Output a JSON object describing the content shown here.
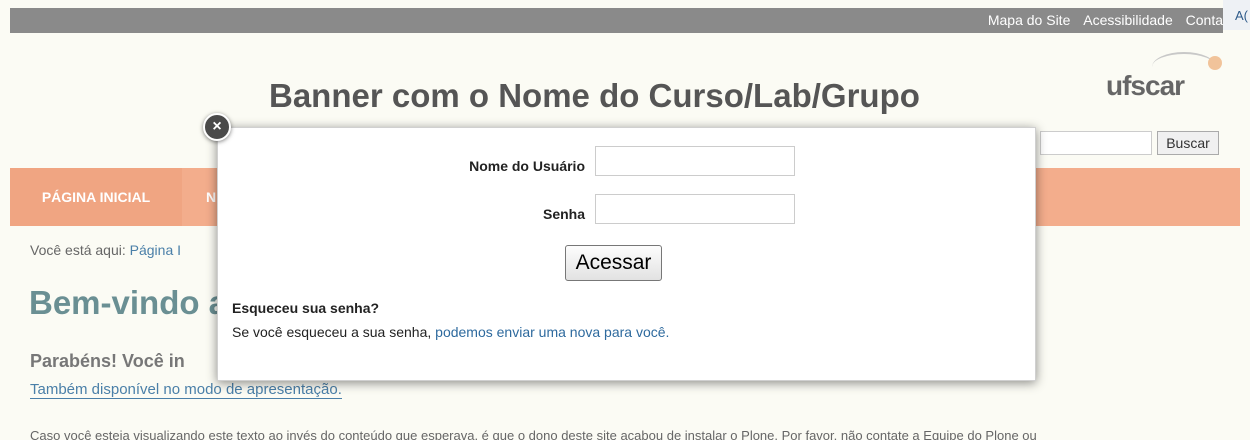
{
  "topbar": {
    "links": [
      "Mapa do Site",
      "Acessibilidade",
      "Conta"
    ],
    "right_tab_label": "A("
  },
  "banner": {
    "title": "Banner com o Nome do Curso/Lab/Grupo",
    "logo_text": "ufscar"
  },
  "search": {
    "placeholder": "",
    "button_label": "Buscar"
  },
  "nav": {
    "items": [
      "PÁGINA INICIAL",
      "N"
    ]
  },
  "breadcrumb": {
    "prefix": "Você está aqui:",
    "current": "Página I"
  },
  "content": {
    "title": "Bem-vindo a",
    "subtitle": "Parabéns! Você in",
    "presentation_link": "Também disponível no modo de apresentação.",
    "body_text": "Caso você esteja visualizando este texto ao invés do conteúdo que esperava, é que o dono deste site acabou de instalar o Plone. Por favor, não contate a Equipe do Plone ou"
  },
  "login_modal": {
    "close_label": "×",
    "username_label": "Nome do Usuário",
    "username_value": "",
    "password_label": "Senha",
    "password_value": "",
    "submit_label": "Acessar",
    "forgot_heading": "Esqueceu sua senha?",
    "forgot_text_prefix": "Se você esqueceu a sua senha,",
    "forgot_link": "podemos enviar uma nova para você."
  },
  "colors": {
    "nav_background": "#f3ad8c",
    "topbar_background": "#8a8a8a",
    "link": "#2e6a9e",
    "title_teal": "#6a8f93"
  }
}
